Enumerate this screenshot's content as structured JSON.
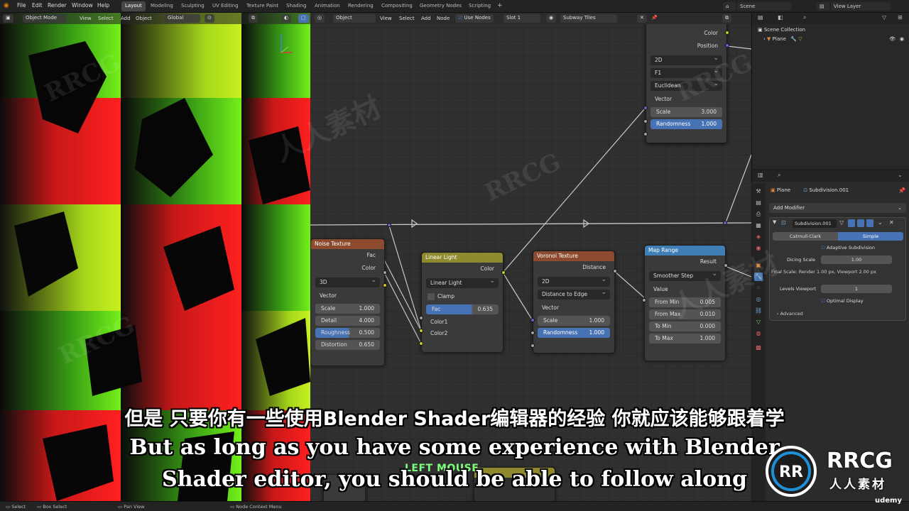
{
  "topbar": {
    "menus": [
      "File",
      "Edit",
      "Render",
      "Window",
      "Help"
    ],
    "workspaces": [
      "Layout",
      "Modeling",
      "Sculpting",
      "UV Editing",
      "Texture Paint",
      "Shading",
      "Animation",
      "Rendering",
      "Compositing",
      "Geometry Nodes",
      "Scripting"
    ],
    "active_workspace": "Layout",
    "scene": "Scene",
    "view_layer": "View Layer"
  },
  "viewport_header": {
    "mode": "Object Mode",
    "menus": [
      "View",
      "Select",
      "Add",
      "Object"
    ],
    "transform": "Global"
  },
  "node_header": {
    "type": "Object",
    "menus": [
      "View",
      "Select",
      "Add",
      "Node"
    ],
    "use_nodes": "Use Nodes",
    "slot": "Slot 1",
    "material": "Subway Tiles"
  },
  "nodes": {
    "voronoi_top": {
      "outputs": [
        "Color",
        "Position"
      ],
      "dims": "2D",
      "feature": "F1",
      "metric": "Euclidean",
      "vector": "Vector",
      "scale_label": "Scale",
      "scale_value": "3.000",
      "rand_label": "Randomness",
      "rand_value": "1.000"
    },
    "noise": {
      "title": "Noise Texture",
      "outputs": [
        "Fac",
        "Color"
      ],
      "dims": "3D",
      "vector": "Vector",
      "rows": [
        {
          "label": "Scale",
          "value": "1.000"
        },
        {
          "label": "Detail",
          "value": "4.000"
        },
        {
          "label": "Roughness",
          "value": "0.500"
        },
        {
          "label": "Distortion",
          "value": "0.650"
        }
      ]
    },
    "linear_light": {
      "title": "Linear Light",
      "output": "Color",
      "mode": "Linear Light",
      "clamp": "Clamp",
      "fac_label": "Fac",
      "fac_value": "0.635",
      "inputs": [
        "Color1",
        "Color2"
      ]
    },
    "voronoi": {
      "title": "Voronoi Texture",
      "output": "Distance",
      "dims": "2D",
      "feature": "Distance to Edge",
      "vector": "Vector",
      "scale_label": "Scale",
      "scale_value": "1.000",
      "rand_label": "Randomness",
      "rand_value": "1.000"
    },
    "map_range": {
      "title": "Map Range",
      "output": "Result",
      "interp": "Smoother Step",
      "value": "Value",
      "rows": [
        {
          "label": "From Min",
          "value": "0.005"
        },
        {
          "label": "From Max",
          "value": "0.010"
        },
        {
          "label": "To Min",
          "value": "0.000"
        },
        {
          "label": "To Max",
          "value": "1.000"
        }
      ]
    }
  },
  "outliner": {
    "collection": "Scene Collection",
    "object": "Plane"
  },
  "properties": {
    "object": "Plane",
    "modifier_name": "Subdivision.001",
    "add_modifier": "Add Modifier",
    "mod_field": "Subdivision.001",
    "tab_catmull": "Catmull-Clark",
    "tab_simple": "Simple",
    "adaptive": "Adaptive Subdivision",
    "dicing_label": "Dicing Scale",
    "dicing_value": "1.00",
    "final_scale": "Final Scale: Render 1.00 px, Viewport 2.00 px",
    "levels_label": "Levels Viewport",
    "levels_value": "1",
    "optimal": "Optimal Display",
    "advanced": "Advanced"
  },
  "statusbar": {
    "items": [
      "Select",
      "Box Select",
      "Pan View",
      "Node Context Menu"
    ]
  },
  "subtitles": {
    "zh": "但是 只要你有一些使用Blender Shader编辑器的经验 你就应该能够跟着学",
    "en1": "But as long as you have some experience with Blender",
    "en2": "Shader editor, you should be able to follow along",
    "key_hint": "LEFT MOUSE"
  },
  "branding": {
    "watermark": "RRCG",
    "watermark_cn": "人人素材",
    "logo_text": "RRCG",
    "logo_sub": "人人素材",
    "udemy": "udemy"
  },
  "colors": {
    "noise_header": "#8c4b2f",
    "mix_header": "#8e8a2d",
    "voronoi_header": "#8c4b2f",
    "maprange_header": "#3f7fb5",
    "accent_blue": "#4772b3"
  }
}
